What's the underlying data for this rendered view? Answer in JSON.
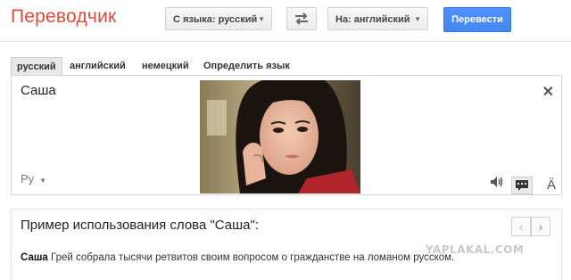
{
  "header": {
    "app_title": "Переводчик",
    "from_lang_label": "С языка: русский",
    "to_lang_label": "На: английский",
    "translate_label": "Перевести"
  },
  "tabs": [
    {
      "label": "русский",
      "active": true
    },
    {
      "label": "английский",
      "active": false
    },
    {
      "label": "немецкий",
      "active": false
    },
    {
      "label": "Определить язык",
      "active": false
    }
  ],
  "input": {
    "source_text": "Саша",
    "detected_lang": "Ру",
    "clear_icon": "close-icon",
    "tool_icons": [
      "speaker-icon",
      "keyboard-icon",
      "font-size-icon"
    ]
  },
  "example": {
    "title": "Пример использования слова \"Саша\":",
    "highlight_word": "Саша",
    "sentence_rest": " Грей собрала тысячи ретвитов своим вопросом о гражданстве на ломаном русском."
  },
  "watermark": "YAPLAKAL.COM",
  "colors": {
    "title_red": "#dd4b39",
    "button_blue": "#4d90fe"
  }
}
